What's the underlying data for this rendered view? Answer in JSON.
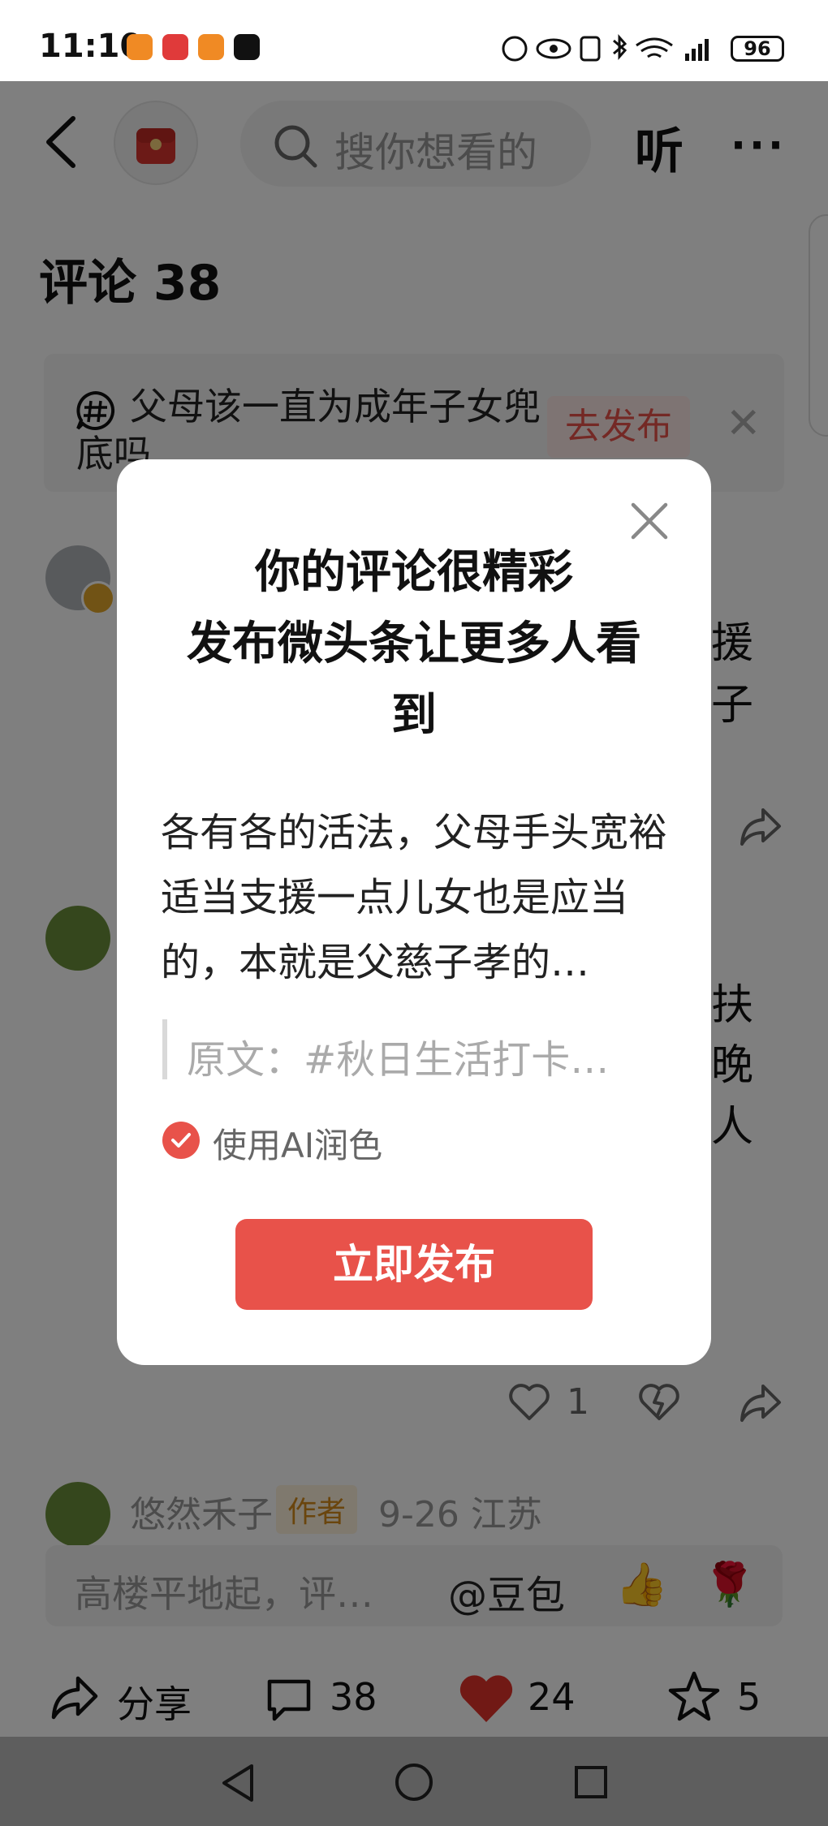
{
  "status_bar": {
    "time": "11:10",
    "battery": "96",
    "app_icons": [
      "home-app-icon",
      "toutiao-app-icon",
      "home-app-icon",
      "capcut-app-icon"
    ]
  },
  "header": {
    "search_placeholder": "搜你想看的",
    "listen_label": "听",
    "more_label": "···"
  },
  "comments": {
    "title": "评论 38",
    "topic": {
      "text": "父母该一直为成年子女兜底吗",
      "button": "去发布"
    },
    "fragments": [
      "援",
      "子",
      "扶",
      "晚",
      "人"
    ],
    "like_count": "1",
    "last_comment": {
      "name": "悠然禾子",
      "badge": "作者",
      "meta": "9-26  江苏"
    }
  },
  "input_bar": {
    "placeholder": "高楼平地起，评…",
    "mention": "@豆包"
  },
  "bottom_bar": {
    "share_label": "分享",
    "comment_count": "38",
    "like_count": "24",
    "favorite_count": "5"
  },
  "modal": {
    "title_line1": "你的评论很精彩",
    "title_line2": "发布微头条让更多人看",
    "title_line3": "到",
    "body": "各有各的活法，父母手头宽裕适当支援一点儿女也是应当的，本就是父慈子孝的…",
    "quote": "原文：#秋日生活打卡…",
    "ai_option_label": "使用AI润色",
    "ai_option_checked": true,
    "publish_button": "立即发布"
  },
  "colors": {
    "accent": "#e8524a",
    "overlay": "rgba(0,0,0,0.5)"
  }
}
